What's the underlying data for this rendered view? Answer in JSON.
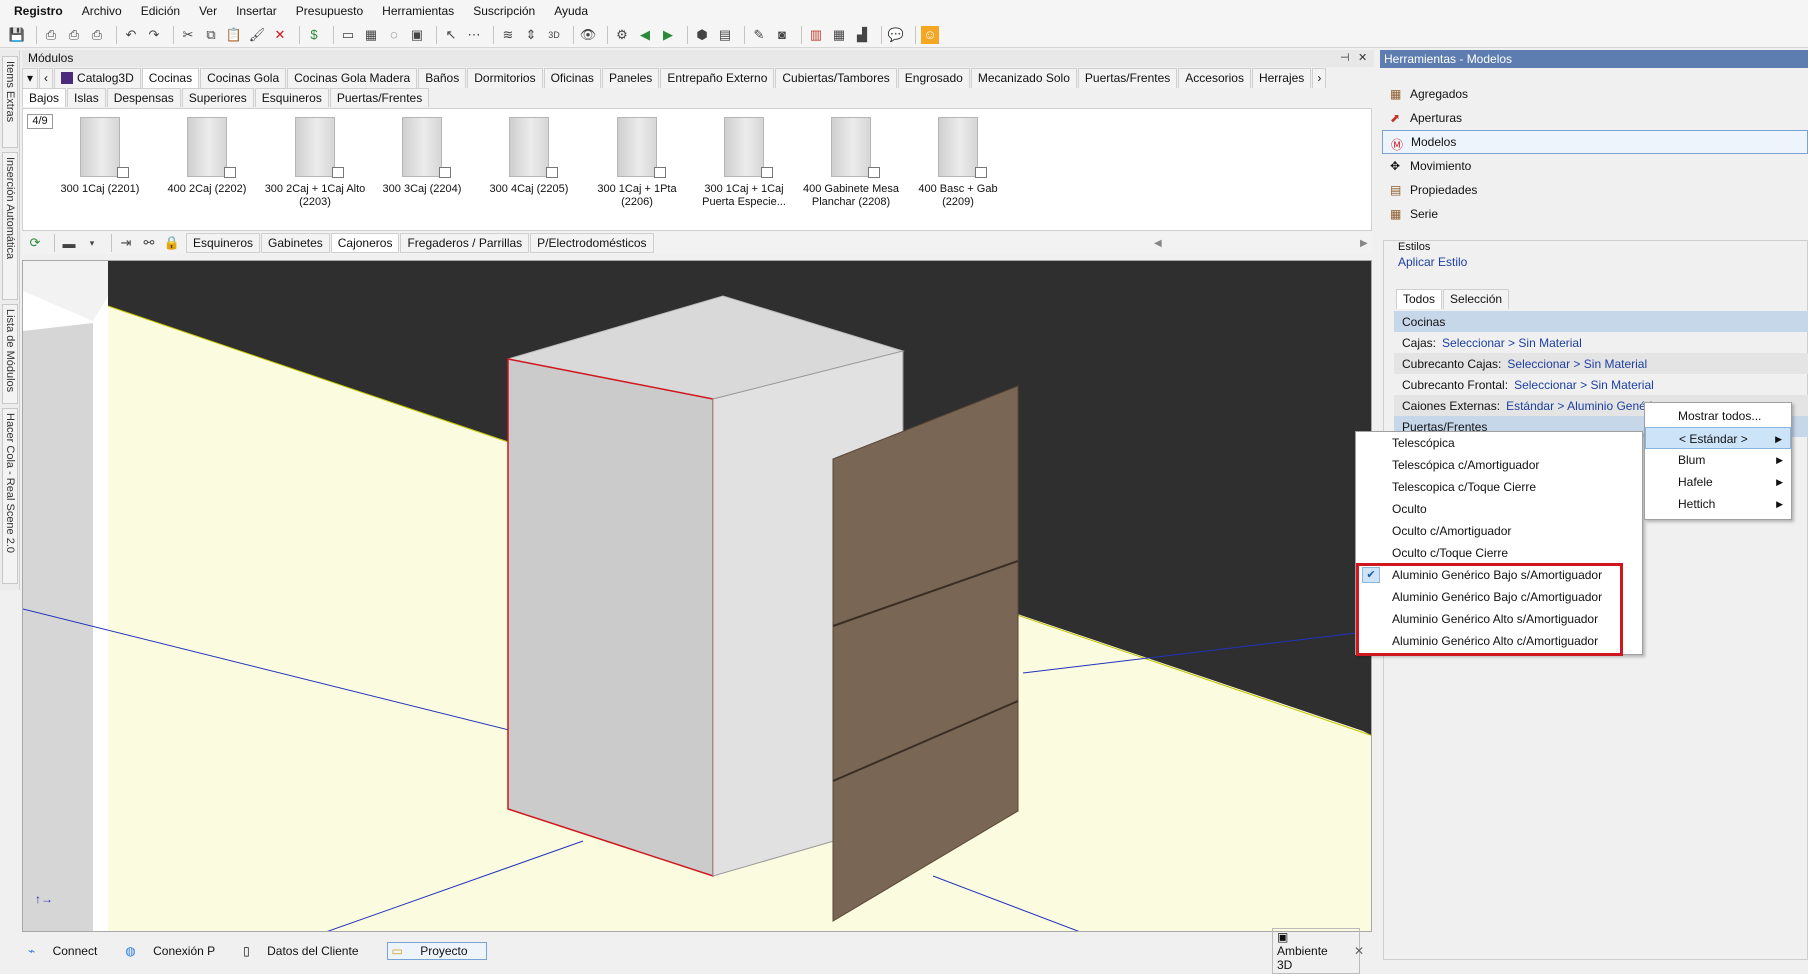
{
  "menubar": {
    "items": [
      "Registro",
      "Archivo",
      "Edición",
      "Ver",
      "Insertar",
      "Presupuesto",
      "Herramientas",
      "Suscripción",
      "Ayuda"
    ]
  },
  "left_tabs": [
    "Items Extras",
    "Inserción Automática",
    "Lista de Módulos",
    "Hacer Cola - Real Scene 2.0"
  ],
  "modules": {
    "title": "Módulos",
    "catalog_tabs": [
      "Catalog3D",
      "Cocinas",
      "Cocinas Gola",
      "Cocinas Gola Madera",
      "Baños",
      "Dormitorios",
      "Oficinas",
      "Paneles",
      "Entrepaño Externo",
      "Cubiertas/Tambores",
      "Engrosado",
      "Mecanizado Solo",
      "Puertas/Frentes",
      "Accesorios",
      "Herrajes"
    ],
    "active_catalog_tab": "Cocinas",
    "sub_tabs": [
      "Bajos",
      "Islas",
      "Despensas",
      "Superiores",
      "Esquineros",
      "Puertas/Frentes"
    ],
    "page_indicator": "4/9",
    "items": [
      {
        "label": "300 1Caj (2201)"
      },
      {
        "label": "400 2Caj (2202)"
      },
      {
        "label": "300 2Caj + 1Caj Alto (2203)"
      },
      {
        "label": "300 3Caj (2204)"
      },
      {
        "label": "300 4Caj (2205)"
      },
      {
        "label": "300 1Caj + 1Pta (2206)"
      },
      {
        "label": "300 1Caj + 1Caj Puerta Especie..."
      },
      {
        "label": "400 Gabinete Mesa Planchar (2208)"
      },
      {
        "label": "400 Basc + Gab (2209)"
      }
    ],
    "filter_tabs": [
      "Esquineros",
      "Gabinetes",
      "Cajoneros",
      "Fregaderos / Parrillas",
      "P/Electrodomésticos"
    ],
    "active_filter_tab": "Cajoneros"
  },
  "statusbar": {
    "items": [
      "Connect",
      "Conexión P",
      "Datos del Cliente",
      "Proyecto"
    ],
    "right": "Ambiente 3D"
  },
  "right_panel": {
    "title": "Herramientas - Modelos",
    "items": [
      "Agregados",
      "Aperturas",
      "Modelos",
      "Movimiento",
      "Propiedades",
      "Serie"
    ],
    "selected": "Modelos",
    "estilos_label": "Estilos",
    "aplicar_estilo": "Aplicar Estilo",
    "tabs": [
      "Todos",
      "Selección"
    ],
    "group1": "Cocinas",
    "rows": [
      {
        "label": "Cajas:",
        "value": "Seleccionar > Sin Material"
      },
      {
        "label": "Cubrecanto Cajas:",
        "value": "Seleccionar > Sin Material"
      },
      {
        "label": "Cubrecanto Frontal:",
        "value": "Seleccionar > Sin Material"
      },
      {
        "label": "Caiones Externas:",
        "value": "Estándar > Aluminio Genéric"
      }
    ],
    "group2": "Puertas/Frentes"
  },
  "context_menu": {
    "items": [
      "Telescópica",
      "Telescópica c/Amortiguador",
      "Telescopica c/Toque Cierre",
      "Oculto",
      "Oculto c/Amortiguador",
      "Oculto c/Toque Cierre",
      "Aluminio Genérico Bajo s/Amortiguador",
      "Aluminio Genérico Bajo c/Amortiguador",
      "Aluminio Genérico Alto s/Amortiguador",
      "Aluminio Genérico Alto c/Amortiguador"
    ],
    "checked": "Aluminio Genérico Bajo s/Amortiguador"
  },
  "submenu": {
    "items": [
      "Mostrar todos...",
      "< Estándar >",
      "Blum",
      "Hafele",
      "Hettich"
    ],
    "highlighted": "< Estándar >"
  },
  "colors": {
    "accent": "#5d7db0",
    "highlight_box": "#d0161e",
    "wall": "#2f2f2f",
    "floor": "#fbfbe0",
    "wood": "#7a6654"
  }
}
